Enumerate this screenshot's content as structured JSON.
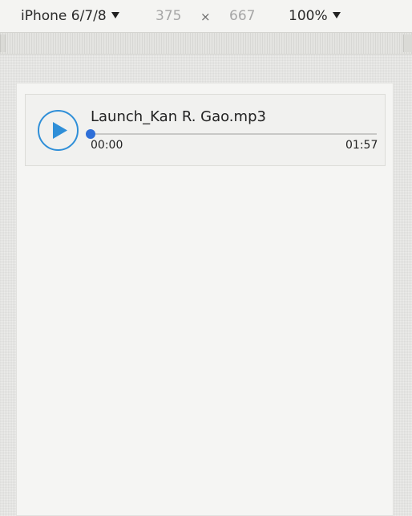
{
  "toolbar": {
    "device": "iPhone 6/7/8",
    "width": "375",
    "times": "×",
    "height": "667",
    "zoom": "100%"
  },
  "player": {
    "title": "Launch_Kan R. Gao.mp3",
    "current_time": "00:00",
    "total_time": "01:57",
    "progress": 0,
    "accent": "#2f8fd8"
  },
  "icons": {
    "play": "play-icon",
    "dropdown": "caret-down-icon"
  }
}
